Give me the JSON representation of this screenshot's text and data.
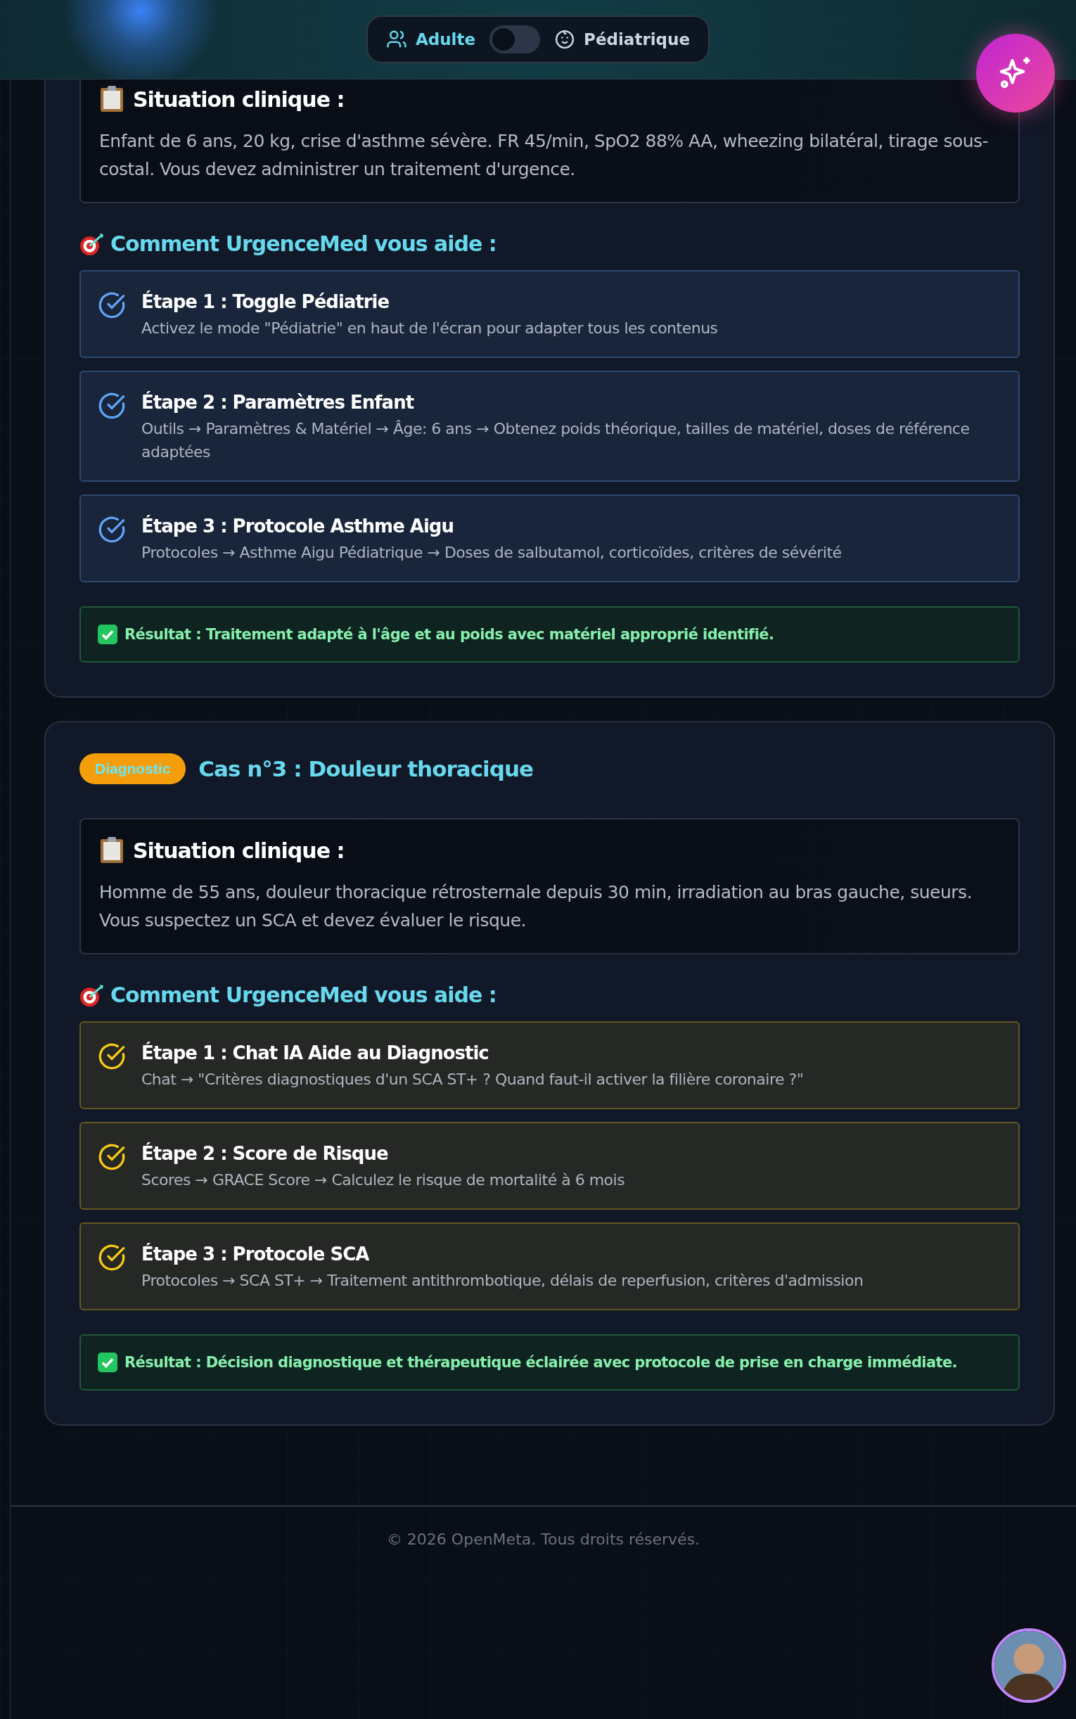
{
  "mode_toggle": {
    "options": [
      {
        "label": "Adulte",
        "selected": true
      },
      {
        "label": "Pédiatrique",
        "selected": false
      }
    ],
    "on": false
  },
  "cases": [
    {
      "color": "#60a5fa",
      "situation": {
        "title": "Situation clinique :",
        "text": "Enfant de 6 ans, 20 kg, crise d'asthme sévère. FR 45/min, SpO2 88% AA, wheezing bilatéral, tirage sous-costal. Vous devez administrer un traitement d'urgence."
      },
      "help_title": "Comment UrgenceMed vous aide :",
      "steps": [
        {
          "title": "Étape 1 : Toggle Pédiatrie",
          "text": "Activez le mode \"Pédiatrie\" en haut de l'écran pour adapter tous les contenus"
        },
        {
          "title": "Étape 2 : Paramètres Enfant",
          "text": "Outils → Paramètres & Matériel → Âge: 6 ans → Obtenez poids théorique, tailles de matériel, doses de référence adaptées"
        },
        {
          "title": "Étape 3 : Protocole Asthme Aigu",
          "text": "Protocoles → Asthme Aigu Pédiatrique → Doses de salbutamol, corticoïdes, critères de sévérité"
        }
      ],
      "result": "**Résultat :** Traitement adapté à l'âge et au poids avec matériel approprié identifié."
    },
    {
      "color": "#facc15",
      "badge": "Diagnostic",
      "title": "Cas n°3 : Douleur thoracique",
      "situation": {
        "title": "Situation clinique :",
        "text": "Homme de 55 ans, douleur thoracique rétrosternale depuis 30 min, irradiation au bras gauche, sueurs. Vous suspectez un SCA et devez évaluer le risque."
      },
      "help_title": "Comment UrgenceMed vous aide :",
      "steps": [
        {
          "title": "Étape 1 : Chat IA Aide au Diagnostic",
          "text": "Chat → \"Critères diagnostiques d'un SCA ST+ ? Quand faut-il activer la filière coronaire ?\""
        },
        {
          "title": "Étape 2 : Score de Risque",
          "text": "Scores → GRACE Score → Calculez le risque de mortalité à 6 mois"
        },
        {
          "title": "Étape 3 : Protocole SCA",
          "text": "Protocoles → SCA ST+ → Traitement antithrombotique, délais de reperfusion, critères d'admission"
        }
      ],
      "result": "**Résultat :** Décision diagnostique et thérapeutique éclairée avec protocole de prise en charge immédiate."
    }
  ],
  "footer": "© 2026 OpenMeta. Tous droits réservés."
}
